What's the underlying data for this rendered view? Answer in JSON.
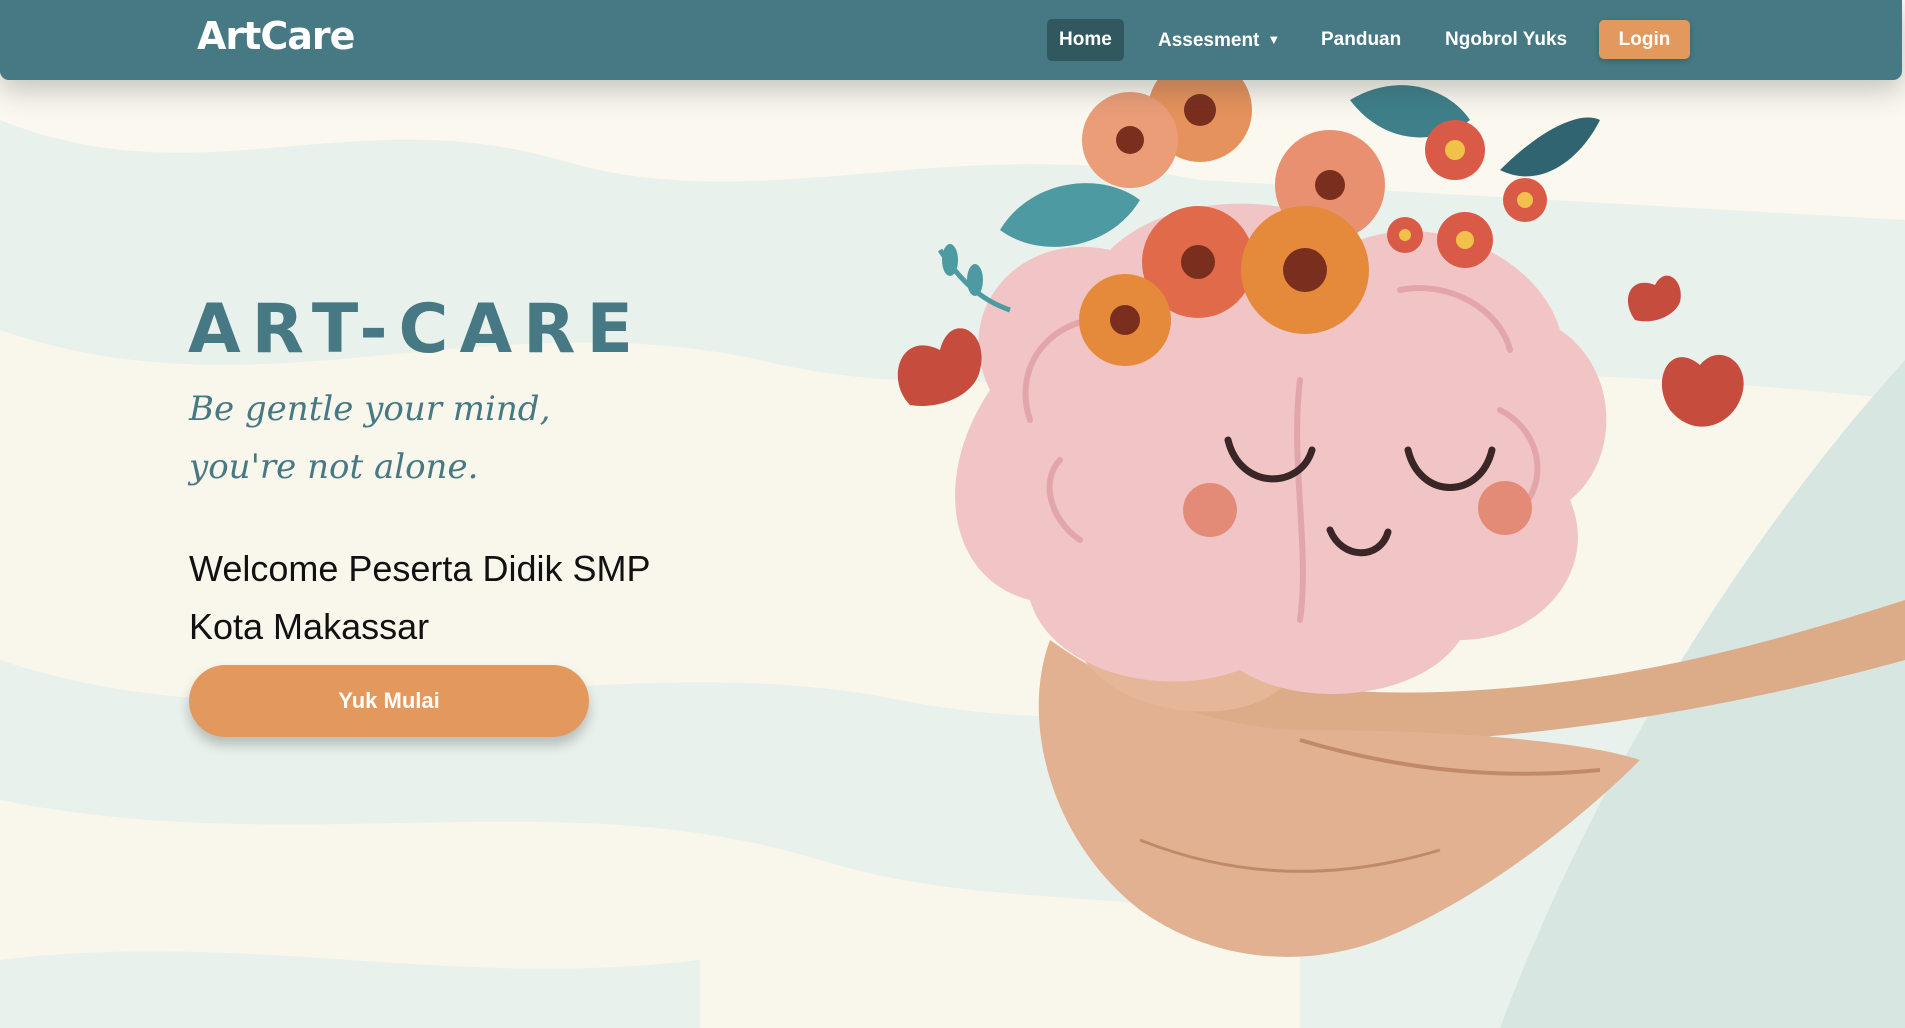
{
  "header": {
    "brand": "ArtCare",
    "nav": {
      "home": "Home",
      "assessment": "Assesment",
      "assessment_caret": "▼",
      "panduan": "Panduan",
      "ngobrol": "Ngobrol Yuks"
    },
    "login_label": "Login"
  },
  "hero": {
    "title": "ART-CARE",
    "tagline_line1": "Be gentle your mind,",
    "tagline_line2": "you're not alone.",
    "welcome_line1": "Welcome Peserta Didik SMP",
    "welcome_line2": "Kota Makassar",
    "cta_label": "Yuk Mulai"
  },
  "colors": {
    "navbar": "#467983",
    "nav_active": "#31575f",
    "accent": "#e3995e",
    "title": "#467983",
    "page_background": "#fbf8ef"
  },
  "icons": {
    "dropdown": "caret-down-icon",
    "illustration": "brain-in-hands-illustration"
  }
}
